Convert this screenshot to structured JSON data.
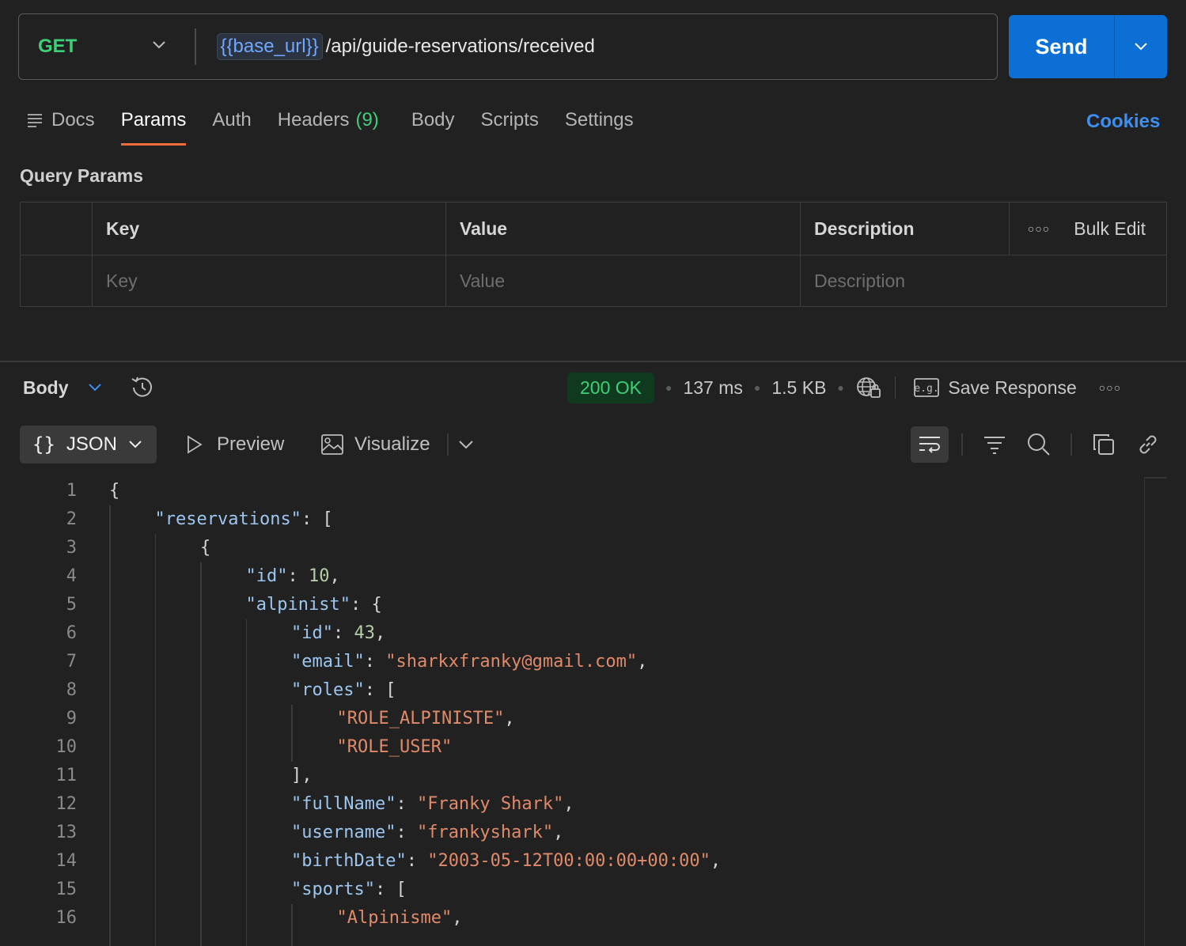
{
  "request": {
    "method": "GET",
    "url_variable": "{{base_url}}",
    "url_path": "/api/guide-reservations/received",
    "send_label": "Send"
  },
  "tabs": [
    {
      "label": "Docs"
    },
    {
      "label": "Params"
    },
    {
      "label": "Auth"
    },
    {
      "label": "Headers",
      "count": "(9)"
    },
    {
      "label": "Body"
    },
    {
      "label": "Scripts"
    },
    {
      "label": "Settings"
    }
  ],
  "cookies_label": "Cookies",
  "query_params": {
    "title": "Query Params",
    "headers": {
      "key": "Key",
      "value": "Value",
      "description": "Description",
      "bulk_edit": "Bulk Edit"
    },
    "placeholders": {
      "key": "Key",
      "value": "Value",
      "description": "Description"
    }
  },
  "response": {
    "body_label": "Body",
    "status": "200 OK",
    "time": "137 ms",
    "size": "1.5 KB",
    "save_response": "Save Response",
    "format": "JSON",
    "preview_label": "Preview",
    "visualize_label": "Visualize"
  },
  "code_lines": [
    {
      "n": "1",
      "indent": 0,
      "parts": [
        {
          "t": "{",
          "c": "p"
        }
      ]
    },
    {
      "n": "2",
      "indent": 1,
      "parts": [
        {
          "t": "\"reservations\"",
          "c": "k"
        },
        {
          "t": ": [",
          "c": "p"
        }
      ]
    },
    {
      "n": "3",
      "indent": 2,
      "parts": [
        {
          "t": "{",
          "c": "p"
        }
      ]
    },
    {
      "n": "4",
      "indent": 3,
      "parts": [
        {
          "t": "\"id\"",
          "c": "k"
        },
        {
          "t": ": ",
          "c": "p"
        },
        {
          "t": "10",
          "c": "n"
        },
        {
          "t": ",",
          "c": "p"
        }
      ]
    },
    {
      "n": "5",
      "indent": 3,
      "parts": [
        {
          "t": "\"alpinist\"",
          "c": "k"
        },
        {
          "t": ": {",
          "c": "p"
        }
      ]
    },
    {
      "n": "6",
      "indent": 4,
      "parts": [
        {
          "t": "\"id\"",
          "c": "k"
        },
        {
          "t": ": ",
          "c": "p"
        },
        {
          "t": "43",
          "c": "n"
        },
        {
          "t": ",",
          "c": "p"
        }
      ]
    },
    {
      "n": "7",
      "indent": 4,
      "parts": [
        {
          "t": "\"email\"",
          "c": "k"
        },
        {
          "t": ": ",
          "c": "p"
        },
        {
          "t": "\"sharkxfranky@gmail.com\"",
          "c": "s"
        },
        {
          "t": ",",
          "c": "p"
        }
      ]
    },
    {
      "n": "8",
      "indent": 4,
      "parts": [
        {
          "t": "\"roles\"",
          "c": "k"
        },
        {
          "t": ": [",
          "c": "p"
        }
      ]
    },
    {
      "n": "9",
      "indent": 5,
      "parts": [
        {
          "t": "\"ROLE_ALPINISTE\"",
          "c": "s"
        },
        {
          "t": ",",
          "c": "p"
        }
      ]
    },
    {
      "n": "10",
      "indent": 5,
      "parts": [
        {
          "t": "\"ROLE_USER\"",
          "c": "s"
        }
      ]
    },
    {
      "n": "11",
      "indent": 4,
      "parts": [
        {
          "t": "],",
          "c": "p"
        }
      ]
    },
    {
      "n": "12",
      "indent": 4,
      "parts": [
        {
          "t": "\"fullName\"",
          "c": "k"
        },
        {
          "t": ": ",
          "c": "p"
        },
        {
          "t": "\"Franky Shark\"",
          "c": "s"
        },
        {
          "t": ",",
          "c": "p"
        }
      ]
    },
    {
      "n": "13",
      "indent": 4,
      "parts": [
        {
          "t": "\"username\"",
          "c": "k"
        },
        {
          "t": ": ",
          "c": "p"
        },
        {
          "t": "\"frankyshark\"",
          "c": "s"
        },
        {
          "t": ",",
          "c": "p"
        }
      ]
    },
    {
      "n": "14",
      "indent": 4,
      "parts": [
        {
          "t": "\"birthDate\"",
          "c": "k"
        },
        {
          "t": ": ",
          "c": "p"
        },
        {
          "t": "\"2003-05-12T00:00:00+00:00\"",
          "c": "s"
        },
        {
          "t": ",",
          "c": "p"
        }
      ]
    },
    {
      "n": "15",
      "indent": 4,
      "parts": [
        {
          "t": "\"sports\"",
          "c": "k"
        },
        {
          "t": ": [",
          "c": "p"
        }
      ]
    },
    {
      "n": "16",
      "indent": 5,
      "parts": [
        {
          "t": "\"Alpinisme\"",
          "c": "s"
        },
        {
          "t": ",",
          "c": "p"
        }
      ]
    }
  ]
}
